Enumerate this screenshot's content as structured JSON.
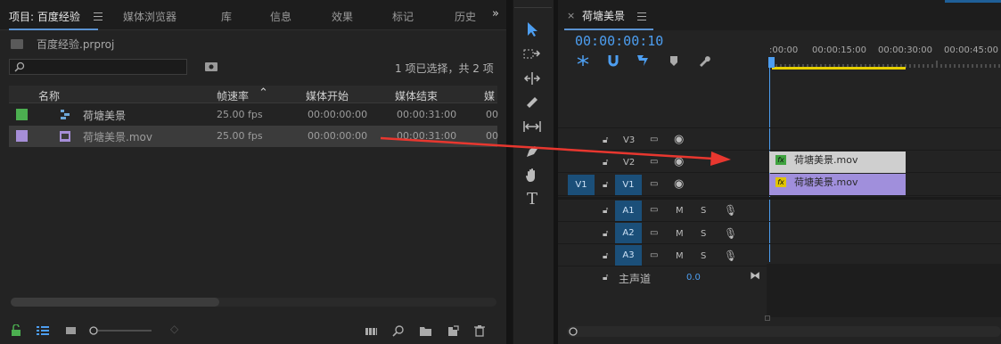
{
  "project_panel": {
    "tabs": [
      "项目: 百度经验",
      "媒体浏览器",
      "库",
      "信息",
      "效果",
      "标记",
      "历史"
    ],
    "project_file": "百度经验.prproj",
    "search_placeholder": "",
    "selection_status": "1 项已选择，共 2 项",
    "columns": [
      "名称",
      "帧速率",
      "媒体开始",
      "媒体结束",
      "媒"
    ],
    "rows": [
      {
        "color": "#4caf50",
        "name": "荷塘美景",
        "fps": "25.00 fps",
        "start": "00:00:00:00",
        "end": "00:00:31:00",
        "extra": "00"
      },
      {
        "color": "#a68ed8",
        "name": "荷塘美景.mov",
        "fps": "25.00 fps",
        "start": "00:00:00:00",
        "end": "00:00:31:00",
        "extra": "00"
      }
    ]
  },
  "tools": {
    "type_tool_label": "T"
  },
  "timeline": {
    "sequence_name": "荷塘美景",
    "close_label": "×",
    "timecode": "00:00:00:10",
    "ruler_labels": [
      ":00:00",
      "00:00:15:00",
      "00:00:30:00",
      "00:00:45:00"
    ],
    "tracks": [
      {
        "id": "V3",
        "type": "video"
      },
      {
        "id": "V2",
        "type": "video"
      },
      {
        "id": "V1",
        "type": "video",
        "source": "V1"
      },
      {
        "id": "A1",
        "type": "audio"
      },
      {
        "id": "A2",
        "type": "audio"
      },
      {
        "id": "A3",
        "type": "audio"
      }
    ],
    "mute_label": "M",
    "solo_label": "S",
    "master_label": "主声道",
    "master_value": "0.0",
    "clips": [
      {
        "track": "V2",
        "name": "荷塘美景.mov",
        "color": "#cfcfcf",
        "fx_color": "#3fa33f"
      },
      {
        "track": "V1",
        "name": "荷塘美景.mov",
        "color": "#a08fdc",
        "fx_color": "#e0c400"
      }
    ]
  },
  "annotation": {
    "arrow_color": "#e8372f"
  },
  "colors": {
    "accent_blue": "#4d9ef0",
    "work_area_yellow": "#e6d000",
    "track_target_blue": "#1b4f79"
  }
}
